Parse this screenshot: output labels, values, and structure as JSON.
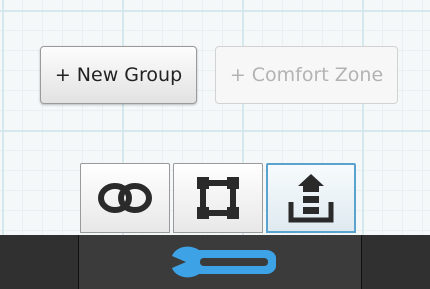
{
  "toolbar": {
    "new_group_label": "+ New Group",
    "comfort_zone_label": "+ Comfort Zone"
  },
  "mode_buttons": [
    {
      "name": "link",
      "icon": "linked-rings-icon",
      "active": false
    },
    {
      "name": "region",
      "icon": "square-nodes-icon",
      "active": false
    },
    {
      "name": "layers",
      "icon": "stack-upload-icon",
      "active": true
    }
  ],
  "bottom_bar": {
    "icon": "wrench-icon",
    "icon_color": "#3ea3e6"
  },
  "colors": {
    "grid_line": "#d4e8ee",
    "active_border": "#5aa3cf",
    "bar_background": "#303030"
  }
}
